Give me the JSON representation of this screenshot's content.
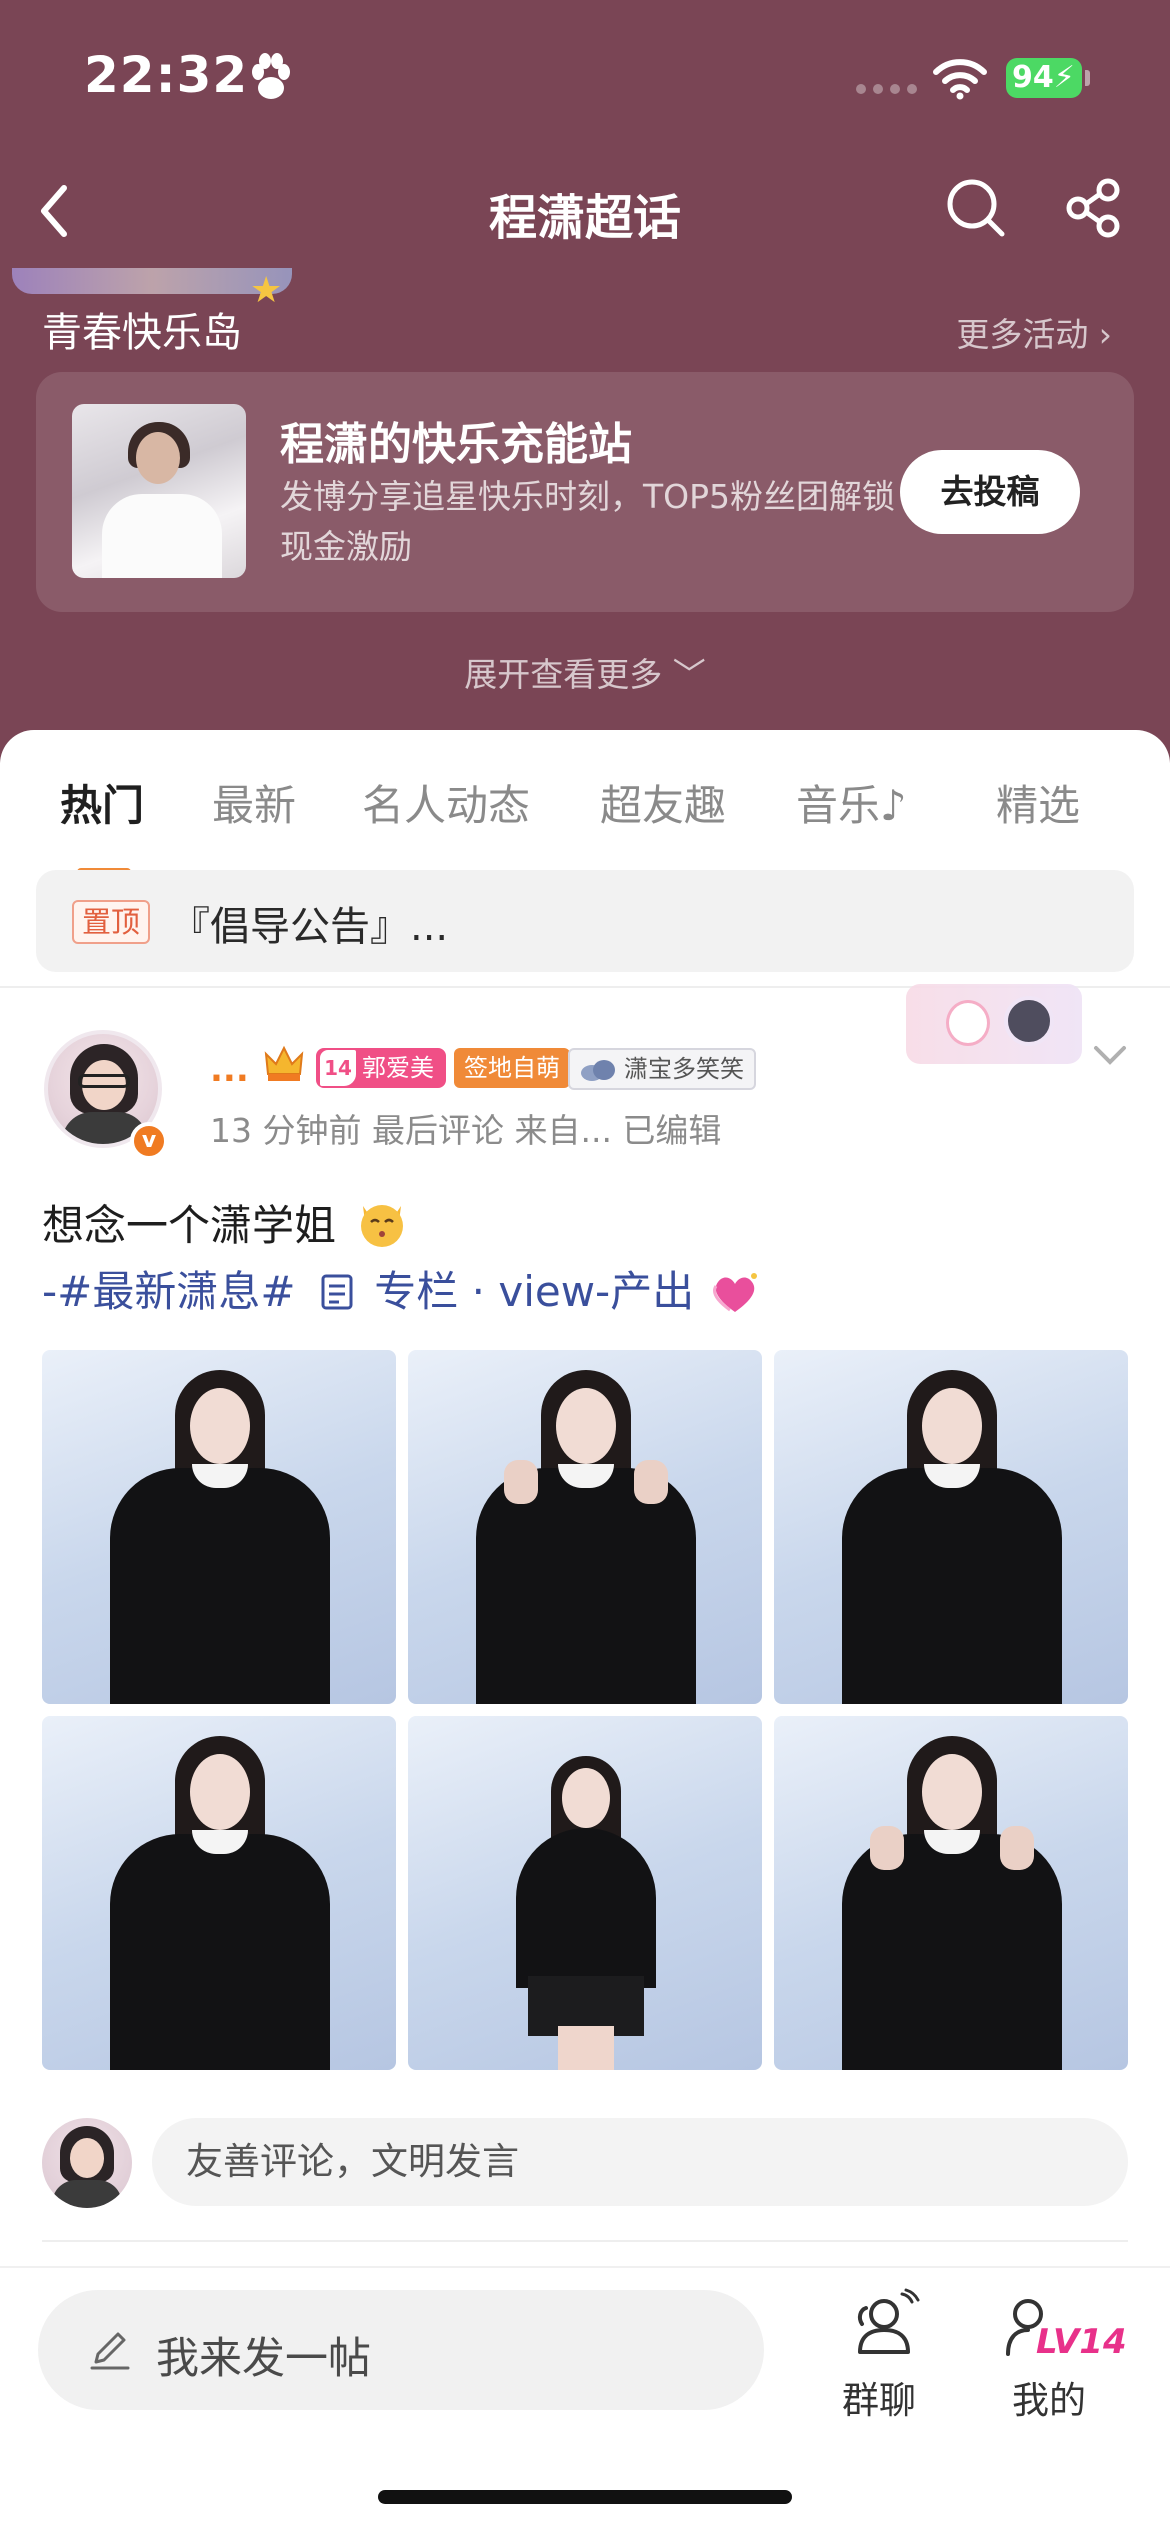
{
  "status_bar": {
    "time": "22:32",
    "battery": "94"
  },
  "nav": {
    "title": "程潇超话"
  },
  "activity_section": {
    "title": "青春快乐岛",
    "more_label": "更多活动 ›",
    "card": {
      "name": "程潇的快乐充能站",
      "description": "发博分享追星快乐时刻，TOP5粉丝团解锁现金激励",
      "button_label": "去投稿"
    },
    "expand_label": "展开查看更多 ﹀"
  },
  "tabs": [
    {
      "label": "热门",
      "active": true
    },
    {
      "label": "最新"
    },
    {
      "label": "名人动态"
    },
    {
      "label": "超友趣"
    },
    {
      "label": "音乐♪"
    },
    {
      "label": "精选"
    }
  ],
  "pinned": {
    "badge": "置顶",
    "text": "『倡导公告』..."
  },
  "post": {
    "author": "...",
    "verified_mark": "v",
    "badges": {
      "fan_level": "14",
      "fan_club": "郭爱美",
      "sign": "签地自萌",
      "cloud": "潇宝多笑笑"
    },
    "meta": "13 分钟前  最后评论   来自...  已编辑",
    "text": "想念一个潇学姐",
    "tags_prefix": "-#最新潇息#",
    "tags_column": "专栏",
    "tags_suffix": " · view-产出",
    "images": [
      {
        "pose": "standing"
      },
      {
        "pose": "waving"
      },
      {
        "pose": "standing"
      },
      {
        "pose": "standing"
      },
      {
        "pose": "full-body"
      },
      {
        "pose": "waving"
      }
    ]
  },
  "comment": {
    "placeholder": "友善评论，文明发言"
  },
  "bottom_bar": {
    "post_entry_label": "我来发一帖",
    "group_chat_label": "群聊",
    "mine_label": "我的",
    "level_badge": "LV14"
  },
  "colors": {
    "header_bg": "#7a4555",
    "accent_orange": "#f08a38",
    "tag_blue": "#3a4f9c",
    "fan_pink": "#f04f86"
  }
}
